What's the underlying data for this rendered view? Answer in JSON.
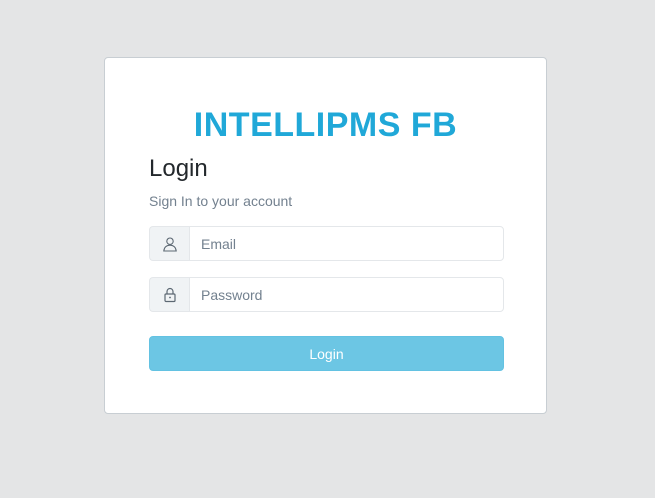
{
  "brand": {
    "title": "INTELLIPMS FB"
  },
  "login": {
    "heading": "Login",
    "subtitle": "Sign In to your account",
    "email": {
      "placeholder": "Email",
      "value": "",
      "icon": "user-icon"
    },
    "password": {
      "placeholder": "Password",
      "value": "",
      "icon": "lock-icon"
    },
    "submit_label": "Login"
  },
  "colors": {
    "brand": "#20a8d8",
    "button": "#6cc6e4",
    "background": "#e4e5e6"
  }
}
